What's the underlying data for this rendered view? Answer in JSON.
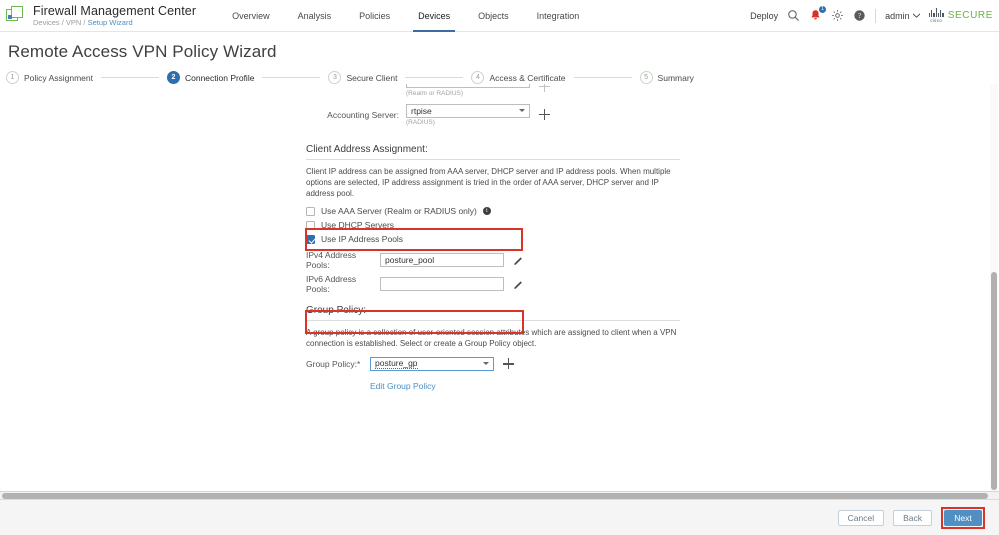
{
  "app": {
    "logo_icon": "overlapping-squares-logo",
    "title": "Firewall Management Center",
    "breadcrumb_prefix": "Devices / VPN / ",
    "breadcrumb_link": "Setup Wizard"
  },
  "nav": {
    "tabs": [
      {
        "label": "Overview",
        "active": false
      },
      {
        "label": "Analysis",
        "active": false
      },
      {
        "label": "Policies",
        "active": false
      },
      {
        "label": "Devices",
        "active": true
      },
      {
        "label": "Objects",
        "active": false
      },
      {
        "label": "Integration",
        "active": false
      }
    ]
  },
  "topright": {
    "deploy_label": "Deploy",
    "search_icon": "search-icon",
    "notifications_icon": "notification-bell-icon",
    "notifications_count": "1",
    "settings_icon": "gear-icon",
    "help_icon": "help-circle-icon",
    "user_label": "admin",
    "user_caret_icon": "chevron-down-icon",
    "brand_mark": "cisco-logo",
    "brand_word": "SECURE",
    "brand_cisco_text": "cisco"
  },
  "page": {
    "title": "Remote Access VPN Policy Wizard"
  },
  "wizard": {
    "steps": [
      {
        "num": "1",
        "label": "Policy Assignment",
        "state": "done"
      },
      {
        "num": "2",
        "label": "Connection Profile",
        "state": "active"
      },
      {
        "num": "3",
        "label": "Secure Client",
        "state": "todo"
      },
      {
        "num": "4",
        "label": "Access & Certificate",
        "state": "todo"
      },
      {
        "num": "5",
        "label": "Summary",
        "state": "todo"
      }
    ]
  },
  "form": {
    "partial_field_hint": "(Realm or RADIUS)",
    "accounting_server": {
      "label": "Accounting Server:",
      "value": "rtpise",
      "hint": "(RADIUS)",
      "add_icon": "plus-icon"
    },
    "client_address_assignment": {
      "title": "Client Address Assignment:",
      "description": "Client IP address can be assigned from AAA server, DHCP server and IP address pools. When multiple options are selected, IP address assignment is tried in the order of AAA server, DHCP server and IP address pool.",
      "checkboxes": [
        {
          "label": "Use AAA Server (Realm or RADIUS only)",
          "checked": false,
          "info_icon": "info-icon"
        },
        {
          "label": "Use DHCP Servers",
          "checked": false,
          "info_icon": ""
        },
        {
          "label": "Use IP Address Pools",
          "checked": true,
          "info_icon": ""
        }
      ],
      "ipv4": {
        "label": "IPv4 Address Pools:",
        "value": "posture_pool",
        "edit_icon": "pencil-icon"
      },
      "ipv6": {
        "label": "IPv6 Address Pools:",
        "value": "",
        "edit_icon": "pencil-icon"
      }
    },
    "group_policy": {
      "title": "Group Policy:",
      "description": "A group policy is a collection of user-oriented session attributes which are assigned to client when a VPN connection is established. Select or create a Group Policy object.",
      "label": "Group Policy:*",
      "value": "posture_gp",
      "add_icon": "plus-icon",
      "edit_link": "Edit Group Policy"
    }
  },
  "footer": {
    "cancel_label": "Cancel",
    "back_label": "Back",
    "next_label": "Next"
  },
  "colors": {
    "accent_blue": "#2f6fae",
    "primary_button": "#4f8fc4",
    "highlight_red": "#d8342a",
    "brand_green": "#6fae45",
    "link_blue": "#4a8fc4"
  }
}
